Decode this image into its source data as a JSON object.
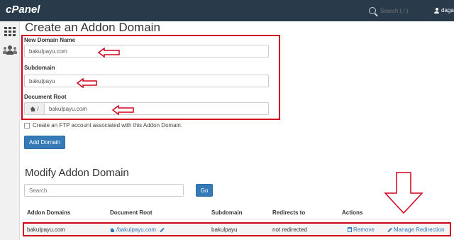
{
  "topbar": {
    "logo": "cPanel",
    "search_placeholder": "Search ( / )",
    "username": "dagas"
  },
  "sidebar": {
    "items": [
      {
        "icon": "grid-icon"
      },
      {
        "icon": "users-icon"
      }
    ]
  },
  "create": {
    "title": "Create an Addon Domain",
    "new_domain_label": "New Domain Name",
    "new_domain_value": "bakulpayu.com",
    "subdomain_label": "Subdomain",
    "subdomain_value": "bakulpayu",
    "docroot_label": "Document Root",
    "docroot_prefix": "/",
    "docroot_value": "bakulpayu.com",
    "ftp_label": "Create an FTP account associated with this Addon Domain.",
    "add_button": "Add Domain"
  },
  "modify": {
    "title": "Modify Addon Domain",
    "search_placeholder": "Search",
    "go_button": "Go",
    "columns": [
      "Addon Domains",
      "Document Root",
      "Subdomain",
      "Redirects to",
      "Actions"
    ],
    "rows": [
      {
        "domain": "bakulpayu.com",
        "docroot": "/bakulpayu.com",
        "subdomain": "bakulpayu",
        "redirect": "not redirected",
        "remove": "Remove",
        "manage": "Manage Redirection"
      }
    ]
  },
  "colors": {
    "topbar": "#293a4a",
    "primary": "#337ab7",
    "annotation": "#d0021b"
  }
}
